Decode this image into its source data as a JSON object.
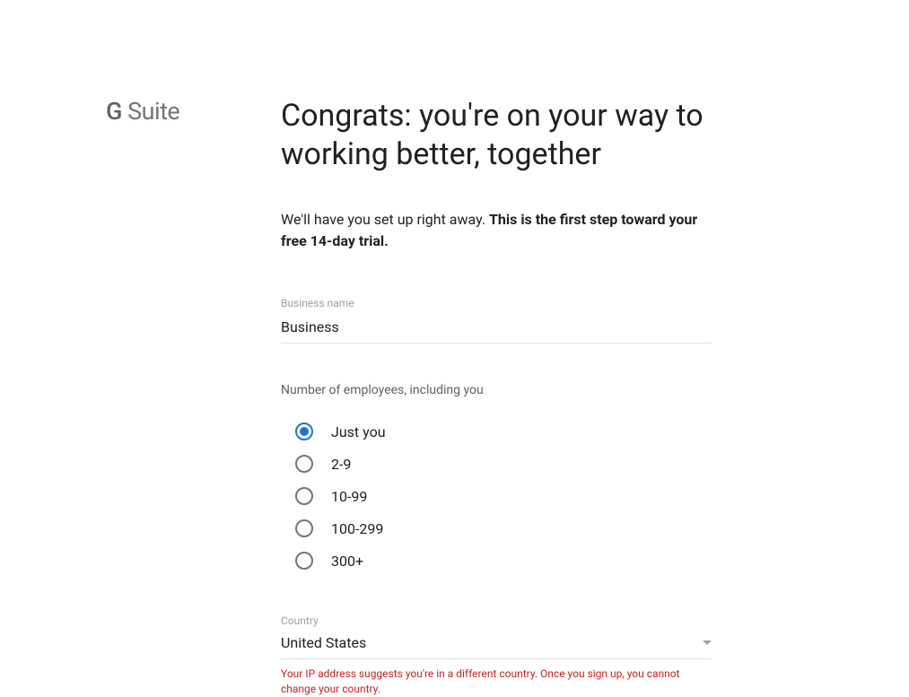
{
  "logo": {
    "g": "G",
    "suite": " Suite"
  },
  "heading": "Congrats: you're on your way to working better, together",
  "subtext": {
    "regular": "We'll have you set up right away. ",
    "bold": "This is the first step toward your free 14-day trial."
  },
  "businessName": {
    "label": "Business name",
    "value": "Business"
  },
  "employees": {
    "label": "Number of employees, including you",
    "options": [
      {
        "label": "Just you",
        "selected": true
      },
      {
        "label": "2-9",
        "selected": false
      },
      {
        "label": "10-99",
        "selected": false
      },
      {
        "label": "100-299",
        "selected": false
      },
      {
        "label": "300+",
        "selected": false
      }
    ]
  },
  "country": {
    "label": "Country",
    "value": "United States",
    "error": "Your IP address suggests you're in a different country. Once you sign up, you cannot change your country."
  }
}
